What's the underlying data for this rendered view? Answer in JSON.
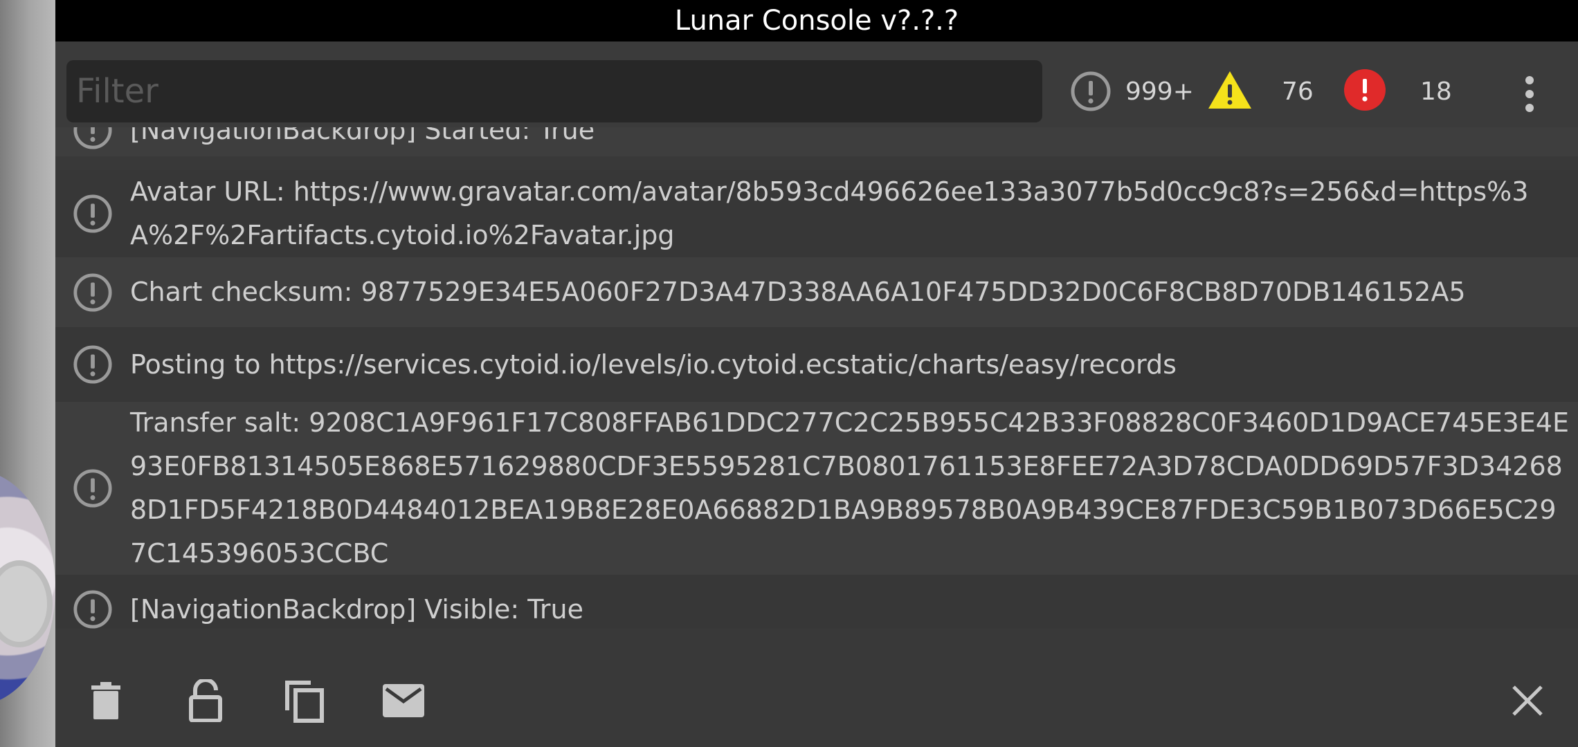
{
  "console": {
    "title": "Lunar Console v?.?.?",
    "filter": {
      "placeholder": "Filter",
      "value": ""
    },
    "counters": {
      "log": "999+",
      "warning": "76",
      "error": "18"
    },
    "colors": {
      "warning": "#f5e21b",
      "error": "#e02a2a",
      "log_icon": "#9a9a9a"
    }
  },
  "logs": [
    {
      "type": "log",
      "message": "[NavigationBackdrop] Started: True"
    },
    {
      "type": "log",
      "message": "Avatar URL: https://www.gravatar.com/avatar/8b593cd496626ee133a3077b5d0cc9c8?s=256&d=https%3A%2F%2Fartifacts.cytoid.io%2Favatar.jpg"
    },
    {
      "type": "log",
      "message": "Chart checksum: 9877529E34E5A060F27D3A47D338AA6A10F475DD32D0C6F8CB8D70DB146152A5"
    },
    {
      "type": "log",
      "message": "Posting to https://services.cytoid.io/levels/io.cytoid.ecstatic/charts/easy/records"
    },
    {
      "type": "log",
      "message": "Transfer salt: 9208C1A9F961F17C808FFAB61DDC277C2C25B955C42B33F08828C0F3460D1D9ACE745E3E4E93E0FB81314505E868E571629880CDF3E5595281C7B0801761153E8FEE72A3D78CDA0DD69D57F3D342688D1FD5F4218B0D4484012BEA19B8E28E0A66882D1BA9B89578B0A9B439CE87FDE3C59B1B073D66E5C297C145396053CCBC"
    },
    {
      "type": "log",
      "message": "[NavigationBackdrop] Visible: True"
    }
  ],
  "bottom_bar": {
    "icons": [
      "trash-icon",
      "lock-open-icon",
      "copy-icon",
      "mail-icon",
      "close-icon"
    ]
  }
}
